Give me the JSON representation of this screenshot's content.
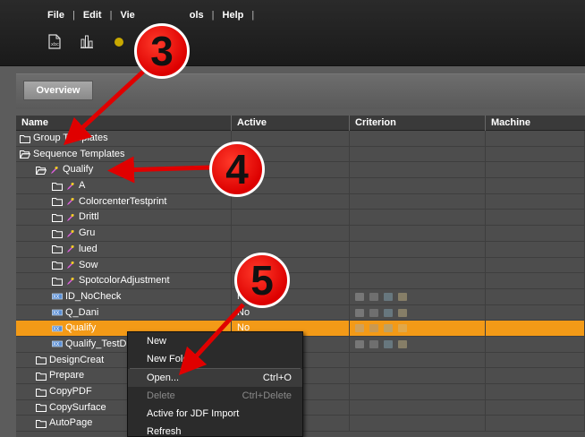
{
  "menubar": {
    "items": [
      {
        "label": "File"
      },
      {
        "label": "Edit"
      },
      {
        "label": "Vie"
      },
      {
        "label": "ols"
      },
      {
        "label": "Help"
      }
    ]
  },
  "toolbar": {
    "icons": [
      "document-icon",
      "chart-icon",
      "settings-icon"
    ]
  },
  "tabs": {
    "overview": "Overview"
  },
  "table": {
    "headers": {
      "name": "Name",
      "active": "Active",
      "criterion": "Criterion",
      "machine": "Machine"
    },
    "rows": [
      {
        "name": "Group Templates",
        "active": "",
        "icon": "folder-icon"
      },
      {
        "name": "Sequence Templates",
        "active": "",
        "icon": "folder-open-icon"
      },
      {
        "name": "Qualify",
        "active": "",
        "icon": "folder-open-icon"
      },
      {
        "name": "A",
        "active": "",
        "icon": "folder-icon"
      },
      {
        "name": "ColorcenterTestprint",
        "active": "",
        "icon": "folder-icon"
      },
      {
        "name": "Drittl",
        "active": "",
        "icon": "folder-icon"
      },
      {
        "name": "Gru",
        "active": "",
        "icon": "folder-icon"
      },
      {
        "name": "lued",
        "active": "",
        "icon": "folder-icon"
      },
      {
        "name": "Sow",
        "active": "",
        "icon": "folder-icon"
      },
      {
        "name": "SpotcolorAdjustment",
        "active": "",
        "icon": "folder-icon"
      },
      {
        "name": "ID_NoCheck",
        "active": "No",
        "icon": "sequence-icon"
      },
      {
        "name": "Q_Dani",
        "active": "No",
        "icon": "sequence-icon"
      },
      {
        "name": "Qualify",
        "active": "No",
        "icon": "sequence-icon"
      },
      {
        "name": "Qualify_TestD",
        "active": "",
        "icon": "sequence-icon"
      },
      {
        "name": "DesignCreat",
        "active": "",
        "icon": "folder-icon"
      },
      {
        "name": "Prepare",
        "active": "",
        "icon": "folder-icon"
      },
      {
        "name": "CopyPDF",
        "active": "",
        "icon": "folder-icon"
      },
      {
        "name": "CopySurface",
        "active": "",
        "icon": "folder-icon"
      },
      {
        "name": "AutoPage",
        "active": "",
        "icon": "folder-icon"
      }
    ]
  },
  "context_menu": {
    "items": [
      {
        "label": "New",
        "shortcut": "",
        "disabled": false
      },
      {
        "label": "New Folder",
        "shortcut": "",
        "disabled": false
      },
      {
        "label": "Open...",
        "shortcut": "Ctrl+O",
        "disabled": false
      },
      {
        "label": "Delete",
        "shortcut": "Ctrl+Delete",
        "disabled": true
      },
      {
        "label": "Active for JDF Import",
        "shortcut": "",
        "disabled": false
      },
      {
        "label": "Refresh",
        "shortcut": "",
        "disabled": false
      }
    ]
  },
  "callouts": {
    "step3": "3",
    "step4": "4",
    "step5": "5"
  },
  "colors": {
    "selected_row": "#f39a17",
    "callout_red": "#dd0000"
  }
}
